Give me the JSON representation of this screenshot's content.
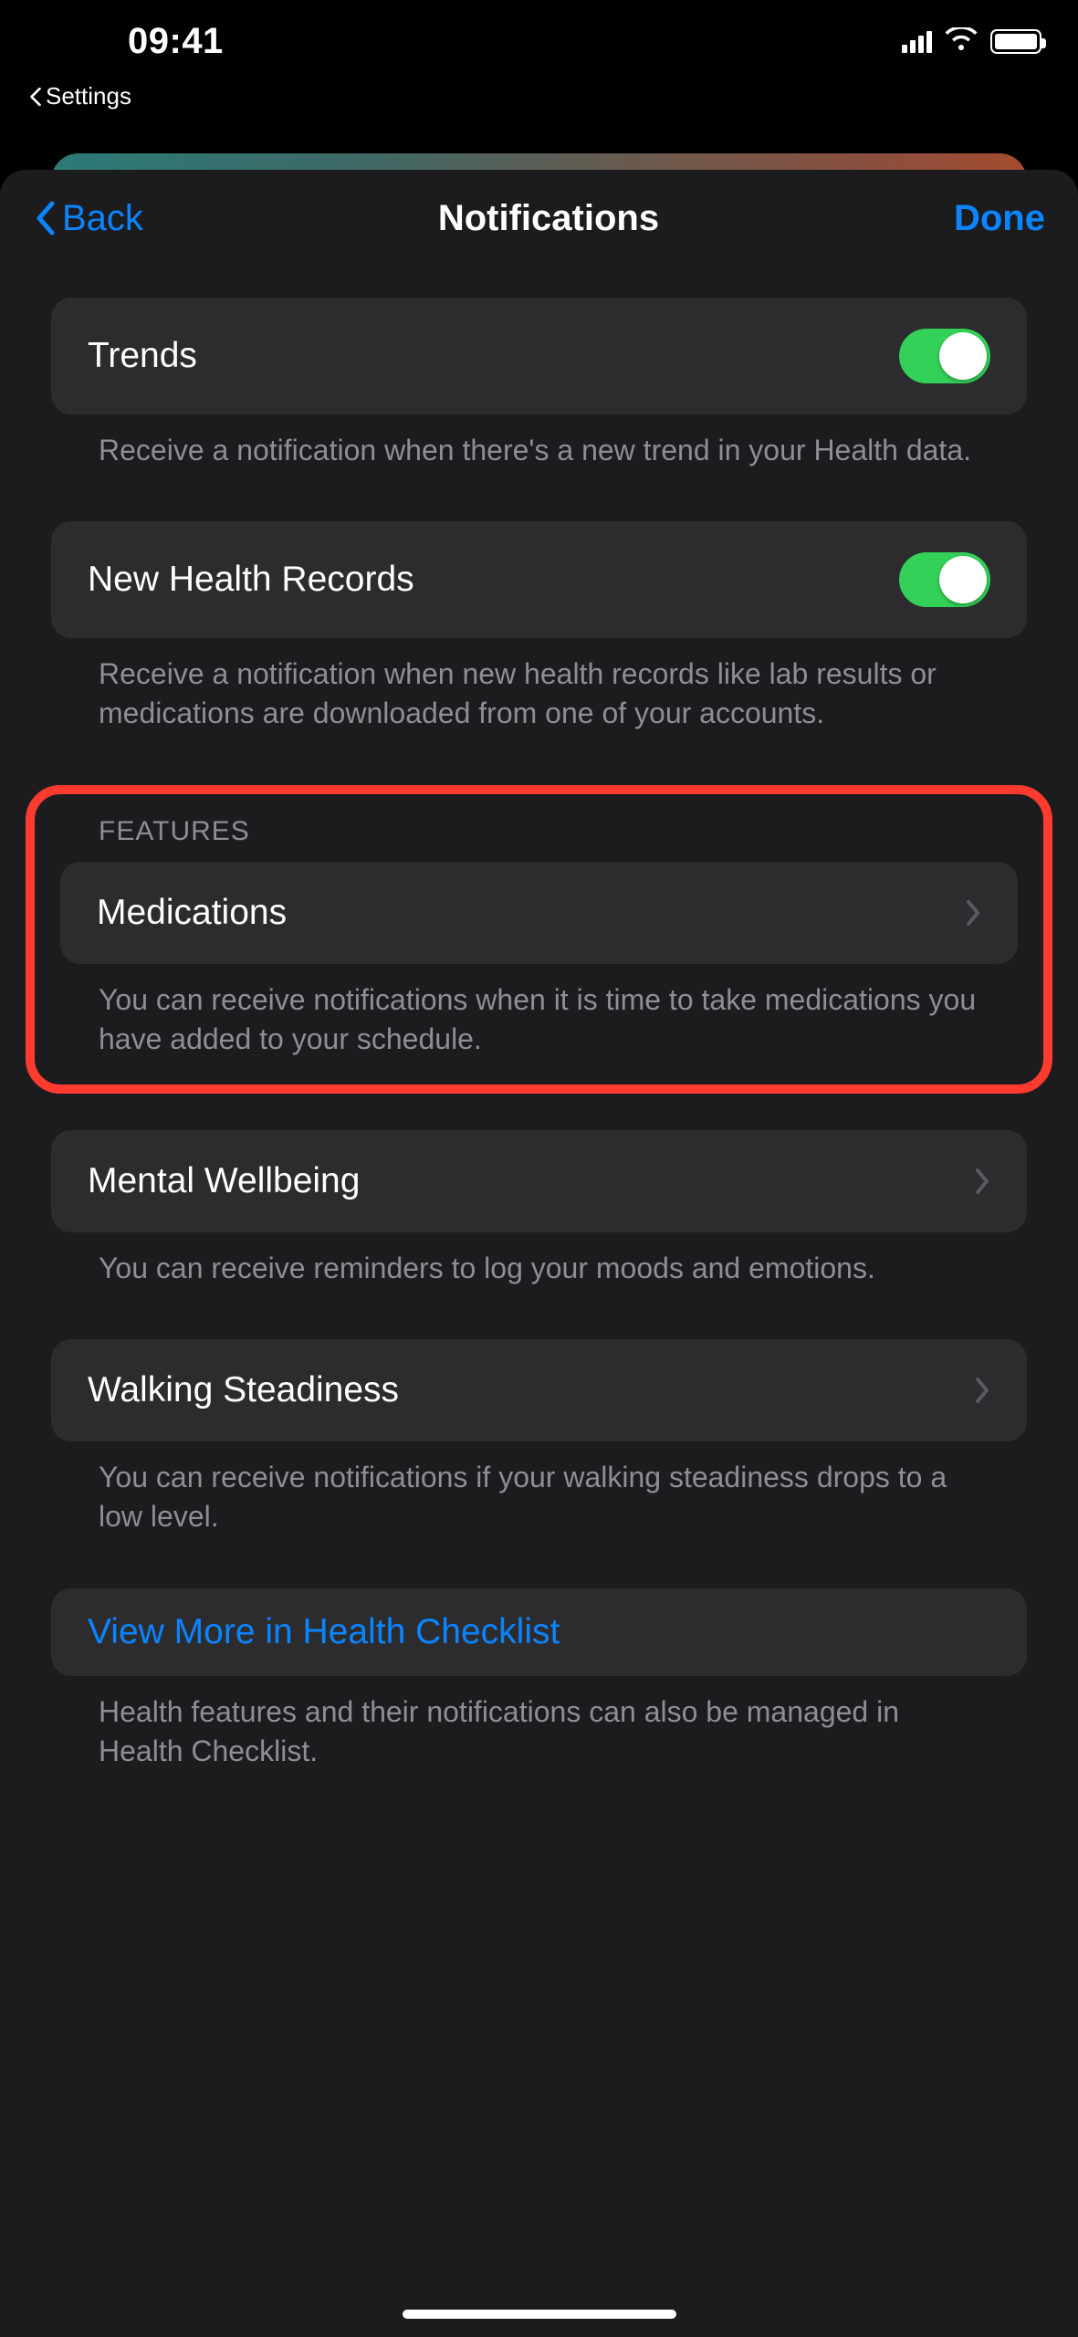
{
  "status": {
    "time": "09:41"
  },
  "return_app": {
    "label": "Settings"
  },
  "nav": {
    "back": "Back",
    "title": "Notifications",
    "done": "Done"
  },
  "rows": {
    "trends": {
      "label": "Trends",
      "on": true,
      "footer": "Receive a notification when there's a new trend in your Health data."
    },
    "records": {
      "label": "New Health Records",
      "on": true,
      "footer": "Receive a notification when new health records like lab results or medications are downloaded from one of your accounts."
    }
  },
  "features": {
    "header": "FEATURES",
    "medications": {
      "label": "Medications",
      "footer": "You can receive notifications when it is time to take medications you have added to your schedule."
    },
    "mental": {
      "label": "Mental Wellbeing",
      "footer": "You can receive reminders to log your moods and emotions."
    },
    "walking": {
      "label": "Walking Steadiness",
      "footer": "You can receive notifications if your walking steadiness drops to a low level."
    },
    "checklist": {
      "label": "View More in Health Checklist",
      "footer": "Health features and their notifications can also be managed in Health Checklist."
    }
  }
}
